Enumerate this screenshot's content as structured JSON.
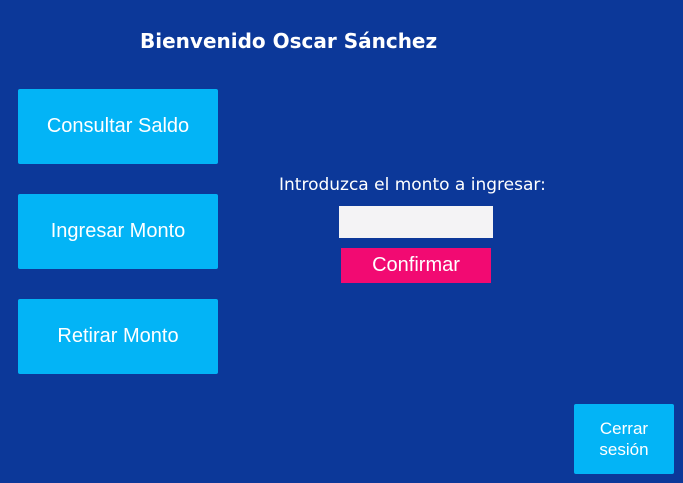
{
  "header": {
    "welcome": "Bienvenido Oscar Sánchez"
  },
  "menu": {
    "consultar_saldo": "Consultar Saldo",
    "ingresar_monto": "Ingresar Monto",
    "retirar_monto": "Retirar Monto"
  },
  "deposit_form": {
    "prompt": "Introduzca el monto a ingresar:",
    "amount_value": "",
    "confirm_label": "Confirmar"
  },
  "session": {
    "logout_label": "Cerrar sesión"
  },
  "colors": {
    "background": "#0c3899",
    "button": "#03b4f6",
    "confirm": "#f20a72",
    "input": "#f4f3f5"
  }
}
